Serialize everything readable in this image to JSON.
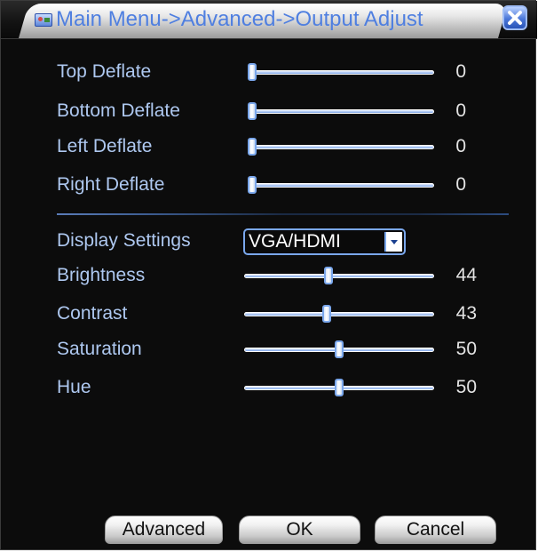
{
  "window": {
    "title": "Main Menu->Advanced->Output Adjust"
  },
  "deflate": [
    {
      "label": "Top Deflate",
      "value": "0",
      "level": 0
    },
    {
      "label": "Bottom Deflate",
      "value": "0",
      "level": 0
    },
    {
      "label": "Left Deflate",
      "value": "0",
      "level": 0
    },
    {
      "label": "Right Deflate",
      "value": "0",
      "level": 0
    }
  ],
  "display_settings": {
    "label": "Display Settings",
    "selected": "VGA/HDMI"
  },
  "picture": [
    {
      "label": "Brightness",
      "value": "44",
      "level": 44
    },
    {
      "label": "Contrast",
      "value": "43",
      "level": 43
    },
    {
      "label": "Saturation",
      "value": "50",
      "level": 50
    },
    {
      "label": "Hue",
      "value": "50",
      "level": 50
    }
  ],
  "buttons": {
    "advanced": "Advanced",
    "ok": "OK",
    "cancel": "Cancel"
  },
  "colors": {
    "label": "#aec8f0",
    "accent": "#4f7fe0",
    "background": "#0c0c0c"
  },
  "icons": {
    "app": "monitor-settings-icon",
    "close": "close-icon",
    "dropdown": "chevron-down-icon"
  }
}
